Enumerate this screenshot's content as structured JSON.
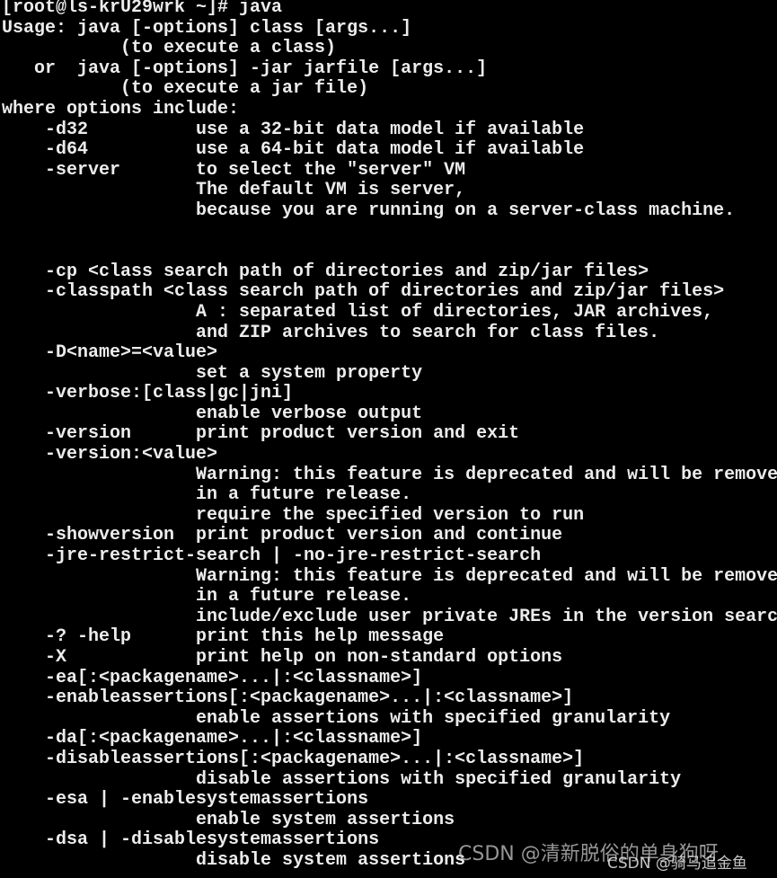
{
  "terminal": {
    "lines": [
      "[root@ls-krU29wrk ~]# java",
      "Usage: java [-options] class [args...]",
      "           (to execute a class)",
      "   or  java [-options] -jar jarfile [args...]",
      "           (to execute a jar file)",
      "where options include:",
      "    -d32          use a 32-bit data model if available",
      "    -d64          use a 64-bit data model if available",
      "    -server       to select the \"server\" VM",
      "                  The default VM is server,",
      "                  because you are running on a server-class machine.",
      "",
      "",
      "    -cp <class search path of directories and zip/jar files>",
      "    -classpath <class search path of directories and zip/jar files>",
      "                  A : separated list of directories, JAR archives,",
      "                  and ZIP archives to search for class files.",
      "    -D<name>=<value>",
      "                  set a system property",
      "    -verbose:[class|gc|jni]",
      "                  enable verbose output",
      "    -version      print product version and exit",
      "    -version:<value>",
      "                  Warning: this feature is deprecated and will be removed",
      "                  in a future release.",
      "                  require the specified version to run",
      "    -showversion  print product version and continue",
      "    -jre-restrict-search | -no-jre-restrict-search",
      "                  Warning: this feature is deprecated and will be removed",
      "                  in a future release.",
      "                  include/exclude user private JREs in the version search",
      "    -? -help      print this help message",
      "    -X            print help on non-standard options",
      "    -ea[:<packagename>...|:<classname>]",
      "    -enableassertions[:<packagename>...|:<classname>]",
      "                  enable assertions with specified granularity",
      "    -da[:<packagename>...|:<classname>]",
      "    -disableassertions[:<packagename>...|:<classname>]",
      "                  disable assertions with specified granularity",
      "    -esa | -enablesystemassertions",
      "                  enable system assertions",
      "    -dsa | -disablesystemassertions",
      "                  disable system assertions"
    ]
  },
  "watermarks": {
    "primary": "CSDN @清新脱俗的单身狗呀",
    "secondary": "CSDN @骑马追金鱼"
  },
  "colors": {
    "background": "#000000",
    "text": "#ececec"
  }
}
